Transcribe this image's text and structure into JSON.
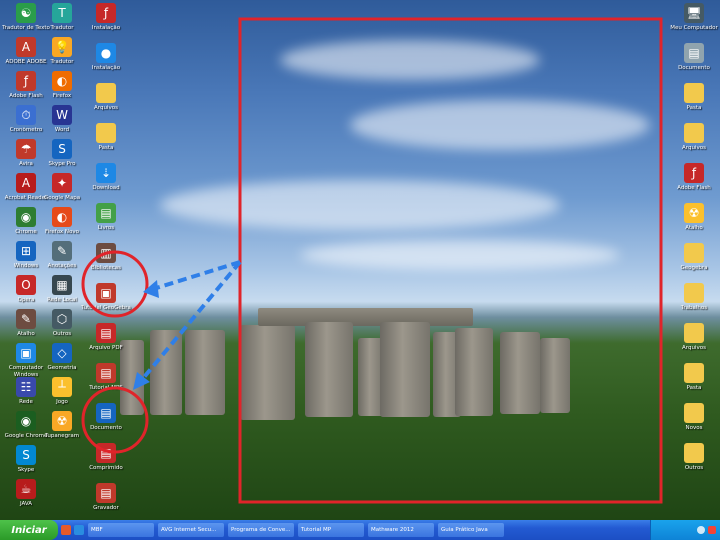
{
  "desktop": {
    "left_icons": [
      {
        "label": "Tradutor de Texto",
        "glyph": "☯",
        "color": "#2a9d4a"
      },
      {
        "label": "ADOBE ADOBE",
        "glyph": "A",
        "color": "#c0392b"
      },
      {
        "label": "Adobe Flash",
        "glyph": "ƒ",
        "color": "#c0392b"
      },
      {
        "label": "Cronômetro",
        "glyph": "⏱",
        "color": "#3b6fd1"
      },
      {
        "label": "Avira",
        "glyph": "☂",
        "color": "#c0392b"
      },
      {
        "label": "Acrobat Reader",
        "glyph": "A",
        "color": "#b71c1c"
      },
      {
        "label": "Chrome",
        "glyph": "◉",
        "color": "#2e7d32"
      },
      {
        "label": "Windows",
        "glyph": "⊞",
        "color": "#1565c0"
      },
      {
        "label": "Opera",
        "glyph": "O",
        "color": "#c62828"
      },
      {
        "label": "Atalho",
        "glyph": "✎",
        "color": "#6d4c41"
      },
      {
        "label": "Computador Windows",
        "glyph": "▣",
        "color": "#1e88e5"
      },
      {
        "label": "Rede",
        "glyph": "☷",
        "color": "#3949ab"
      },
      {
        "label": "Google Chrome",
        "glyph": "◉",
        "color": "#1b5e20"
      },
      {
        "label": "Skype",
        "glyph": "S",
        "color": "#0288d1"
      },
      {
        "label": "JAVA",
        "glyph": "☕",
        "color": "#b71c1c"
      }
    ],
    "col2_icons": [
      {
        "label": "Tradutor",
        "glyph": "T",
        "color": "#26a69a"
      },
      {
        "label": "Tradutor",
        "glyph": "💡",
        "color": "#f9a825"
      },
      {
        "label": "Firefox",
        "glyph": "◐",
        "color": "#ef6c00"
      },
      {
        "label": "Word",
        "glyph": "W",
        "color": "#283593"
      },
      {
        "label": "Skype Pro",
        "glyph": "S",
        "color": "#1565c0"
      },
      {
        "label": "Google Mapa",
        "glyph": "✦",
        "color": "#c62828"
      },
      {
        "label": "Firefox Novo",
        "glyph": "◐",
        "color": "#e64a19"
      },
      {
        "label": "Anotações",
        "glyph": "✎",
        "color": "#546e7a"
      },
      {
        "label": "Rede Local",
        "glyph": "▦",
        "color": "#37474f"
      },
      {
        "label": "Outros",
        "glyph": "⬡",
        "color": "#455a64"
      },
      {
        "label": "Geometria",
        "glyph": "◇",
        "color": "#1565c0"
      },
      {
        "label": "Jogo",
        "glyph": "┴",
        "color": "#fbc02d"
      },
      {
        "label": "Tupanegram",
        "glyph": "☢",
        "color": "#f9a825"
      }
    ],
    "col3_icons": [
      {
        "label": "Instalação",
        "glyph": "ƒ",
        "color": "#c62828"
      },
      {
        "label": "Instalação",
        "glyph": "●",
        "color": "#1e88e5"
      },
      {
        "label": "Arquivos",
        "glyph": "",
        "color": "#f2c94c",
        "folder": true
      },
      {
        "label": "Pasta",
        "glyph": "",
        "color": "#f2c94c",
        "folder": true
      },
      {
        "label": "Download",
        "glyph": "⇣",
        "color": "#1e88e5"
      },
      {
        "label": "Livros",
        "glyph": "▤",
        "color": "#43a047"
      },
      {
        "label": "Bibliotecas",
        "glyph": "▥",
        "color": "#6d4c41"
      },
      {
        "label": "Tutorial GeoGebra",
        "glyph": "▣",
        "color": "#c0392b"
      },
      {
        "label": "Arquivo PDF",
        "glyph": "▤",
        "color": "#c62828"
      },
      {
        "label": "Tutorial MPS",
        "glyph": "▤",
        "color": "#c0392b"
      },
      {
        "label": "Documento",
        "glyph": "▤",
        "color": "#1565c0"
      },
      {
        "label": "Comprimido",
        "glyph": "▤",
        "color": "#c62828"
      },
      {
        "label": "Gravador",
        "glyph": "▤",
        "color": "#c0392b"
      }
    ],
    "right_icons": [
      {
        "label": "Meu Computador",
        "glyph": "🖥",
        "color": "#455a64"
      },
      {
        "label": "Documento",
        "glyph": "▤",
        "color": "#90a4ae"
      },
      {
        "label": "Pasta",
        "glyph": "",
        "color": "#f2c94c",
        "folder": true
      },
      {
        "label": "Arquivos",
        "glyph": "",
        "color": "#f2c94c",
        "folder": true
      },
      {
        "label": "Adobe Flash",
        "glyph": "ƒ",
        "color": "#c62828"
      },
      {
        "label": "Atalho",
        "glyph": "☢",
        "color": "#fbc02d"
      },
      {
        "label": "Geogebra",
        "glyph": "",
        "color": "#f2c94c",
        "folder": true
      },
      {
        "label": "Trabalhos",
        "glyph": "",
        "color": "#f2c94c",
        "folder": true
      },
      {
        "label": "Arquivos",
        "glyph": "",
        "color": "#f2c94c",
        "folder": true
      },
      {
        "label": "Pasta",
        "glyph": "",
        "color": "#f2c94c",
        "folder": true
      },
      {
        "label": "Novos",
        "glyph": "",
        "color": "#f2c94c",
        "folder": true
      },
      {
        "label": "Outros",
        "glyph": "",
        "color": "#f2c94c",
        "folder": true
      }
    ]
  },
  "annotation": {
    "rect_color": "#e0242a",
    "circle_color": "#e0242a",
    "arrow_color": "#2f7fe8"
  },
  "taskbar": {
    "start_label": "Iniciar",
    "tasks": [
      "MBF",
      "AVG Internet Secu...",
      "Programa de Conve...",
      "Tutorial MP",
      "Mathware 2012",
      "Guia Prático Java"
    ],
    "tray_time": ""
  }
}
